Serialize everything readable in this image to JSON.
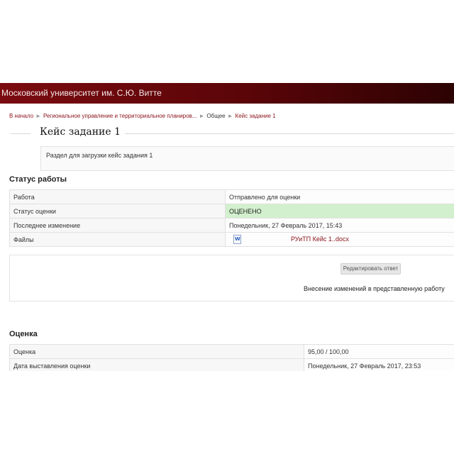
{
  "banner": {
    "title": "Московский университет им. С.Ю. Витте"
  },
  "breadcrumb": {
    "items": [
      "В начало",
      "Региональное управление и территориальное планиров...",
      "Общее",
      "Кейс задание 1"
    ],
    "separator": "►"
  },
  "page": {
    "title": "Кейс задание 1",
    "intro": "Раздел для загрузки кейс задания 1"
  },
  "status": {
    "heading": "Статус работы",
    "rows": [
      {
        "label": "Работа",
        "value": "Отправлено для оценки"
      },
      {
        "label": "Статус оценки",
        "value": "ОЦЕНЕНО"
      },
      {
        "label": "Последнее изменение",
        "value": "Понедельник, 27 Февраль 2017, 15:43"
      },
      {
        "label": "Файлы",
        "value": "РУиТП Кейс 1..docx"
      }
    ],
    "file_icon": "word-document-icon"
  },
  "edit": {
    "button_label": "Редактировать ответ",
    "note": "Внесение изменений в представленную работу"
  },
  "grade": {
    "heading": "Оценка",
    "rows": [
      {
        "label": "Оценка",
        "value": "95,00 / 100,00"
      },
      {
        "label": "Дата выставления оценки",
        "value": "Понедельник, 27 Февраль 2017, 23:53"
      }
    ]
  },
  "colors": {
    "banner_start": "#7a0b10",
    "banner_end": "#2c0203",
    "link": "#8a1218",
    "graded_bg": "#d2f0cd"
  }
}
